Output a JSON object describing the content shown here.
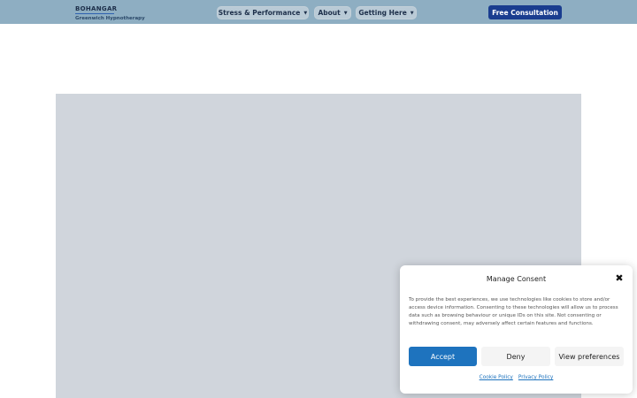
{
  "header": {
    "brand_name": "BOHANGAR",
    "brand_subtitle": "Greenwich Hypnotherapy",
    "nav": [
      {
        "label": "Stress & Performance"
      },
      {
        "label": "About"
      },
      {
        "label": "Getting Here"
      }
    ],
    "cta_label": "Free Consultation"
  },
  "consent": {
    "title": "Manage Consent",
    "close_glyph": "✖",
    "text": "To provide the best experiences, we use technologies like cookies to store and/or access device information. Consenting to these technologies will allow us to process data such as browsing behaviour or unique IDs on this site. Not consenting or withdrawing consent, may adversely affect certain features and functions.",
    "accept_label": "Accept",
    "deny_label": "Deny",
    "preferences_label": "View preferences",
    "cookie_policy_label": "Cookie Policy",
    "privacy_policy_label": "Privacy Policy"
  },
  "colors": {
    "header_bg": "#8eaec2",
    "cta_bg": "#1a3d8f",
    "accept_bg": "#1e73be",
    "hero_placeholder": "#d0d5dc"
  },
  "icons": {
    "caret": "chevron-down-icon",
    "close": "close-icon"
  }
}
